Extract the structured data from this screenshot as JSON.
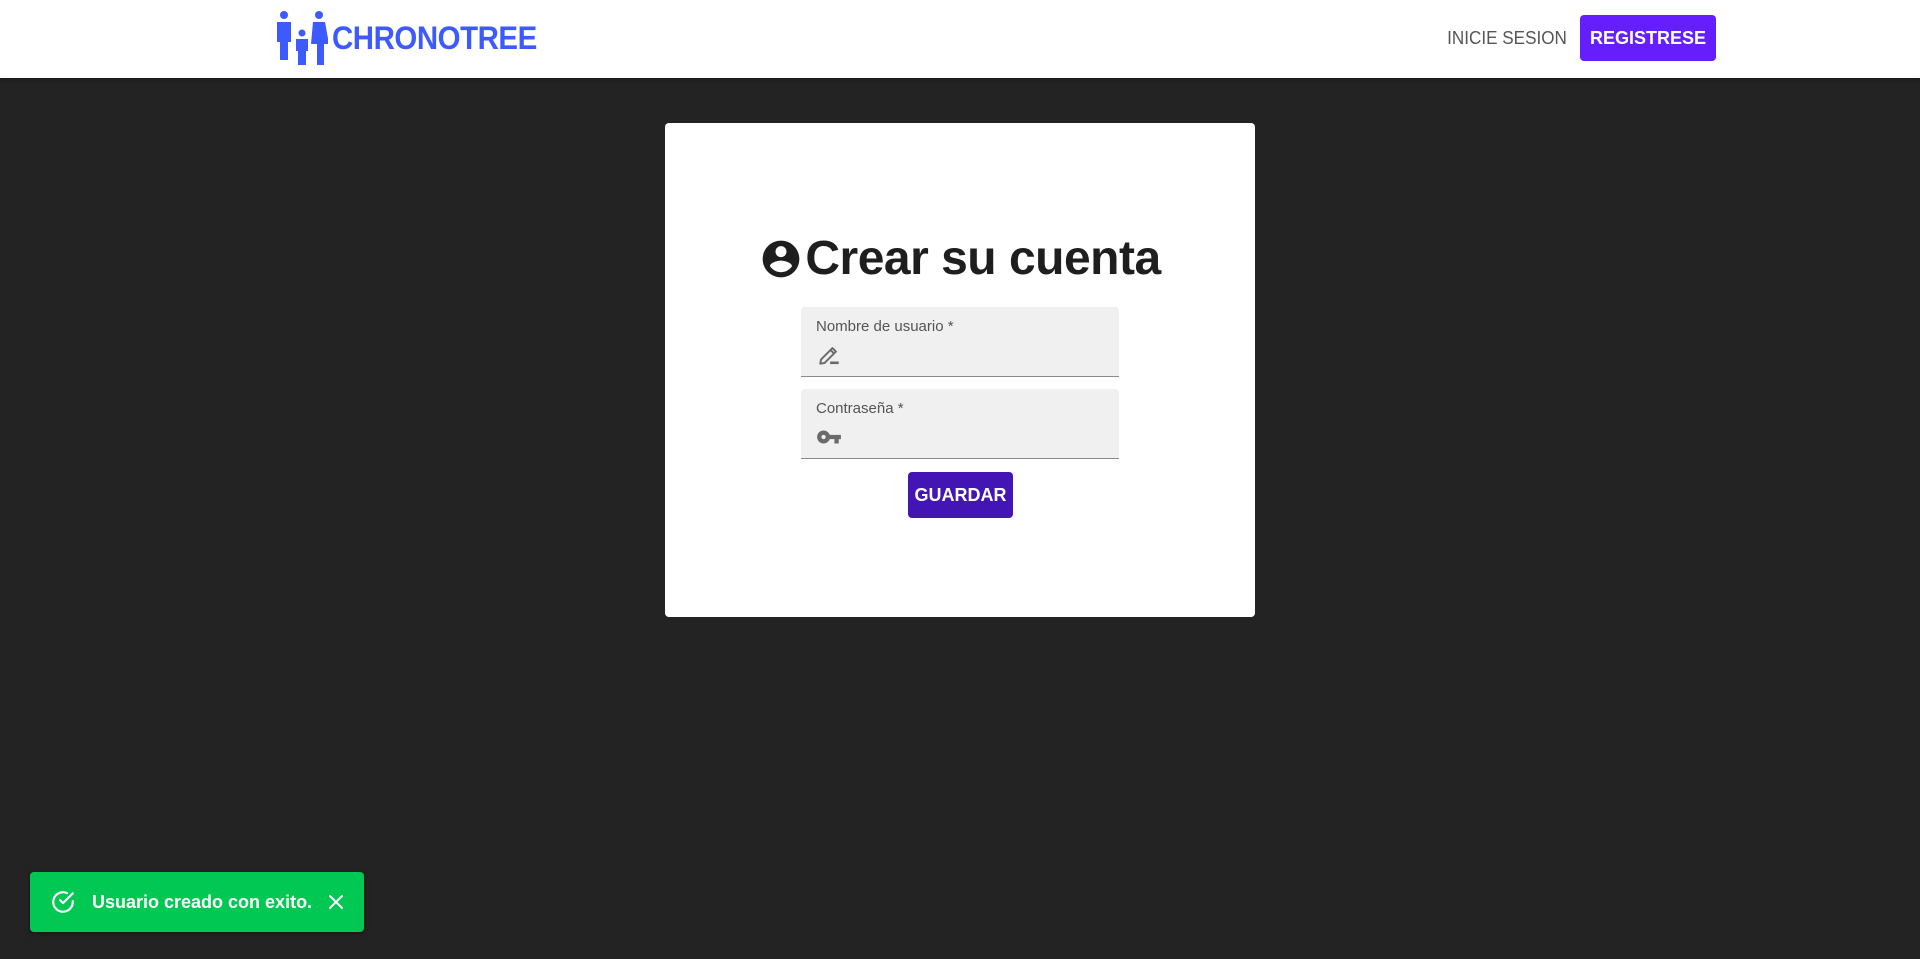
{
  "navbar": {
    "brand_name": "CHRONOTREE",
    "brand_icon": "family-icon",
    "login_label": "INICIE SESION",
    "register_label": "REGISTRESE"
  },
  "form": {
    "title": "Crear su cuenta",
    "title_icon": "account-circle-icon",
    "username": {
      "label": "Nombre de usuario *",
      "value": "",
      "icon": "pencil-icon"
    },
    "password": {
      "label": "Contraseña *",
      "value": "",
      "icon": "key-icon"
    },
    "save_label": "GUARDAR"
  },
  "toast": {
    "message": "Usuario creado con exito.",
    "icon": "check-circle-icon",
    "close_icon": "close-icon"
  },
  "colors": {
    "brand": "#3d5afe",
    "register_button": "#651fff",
    "save_button": "#4315b5",
    "toast_success": "#00c853",
    "background": "#232323"
  }
}
